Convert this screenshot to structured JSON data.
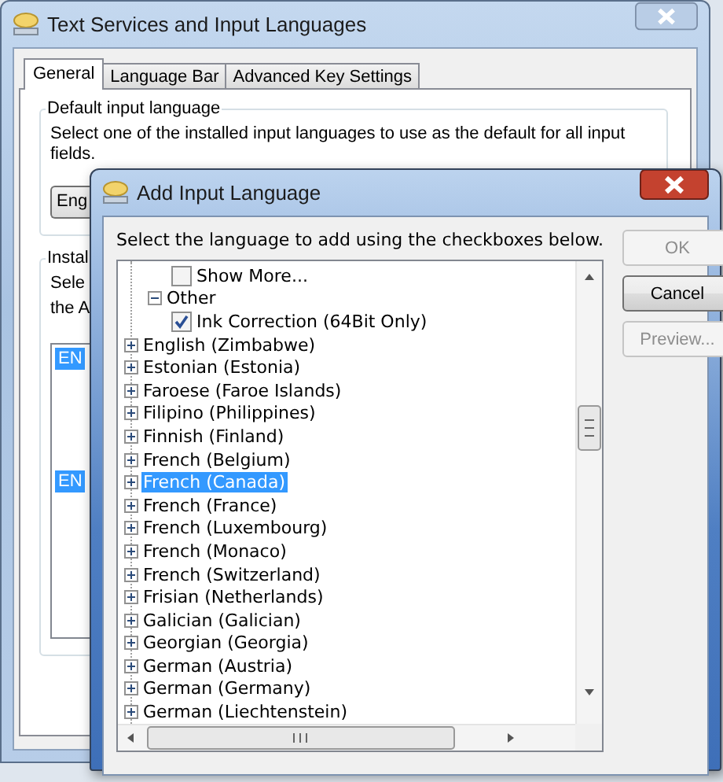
{
  "window": {
    "title": "Text Services and Input Languages"
  },
  "tabs": [
    {
      "label": "General",
      "selected": true
    },
    {
      "label": "Language Bar",
      "selected": false
    },
    {
      "label": "Advanced Key Settings",
      "selected": false
    }
  ],
  "default_input_language": {
    "title": "Default input language",
    "description": "Select one of the installed input languages to use as the default for all input fields.",
    "dropdown_value": "Eng"
  },
  "installed_services": {
    "title": "Instal",
    "description_lines": [
      "Sele",
      "the A"
    ],
    "items": [
      {
        "label": "EN",
        "selected": true
      },
      {
        "label": "EN",
        "selected": true
      }
    ]
  },
  "dialog": {
    "title": "Add Input Language",
    "instruction": "Select the language to add using the checkboxes below.",
    "tree": [
      {
        "children": [
          {
            "children": [
              {
                "label": "Show More...",
                "checked": false
              }
            ]
          },
          {
            "label": "Other",
            "expanded": true,
            "children": [
              {
                "label": "Ink Correction (64Bit Only)",
                "checked": true
              }
            ]
          }
        ]
      },
      {
        "label": "English (Zimbabwe)",
        "expanded": false,
        "selected": false
      },
      {
        "label": "Estonian (Estonia)",
        "expanded": false,
        "selected": false
      },
      {
        "label": "Faroese (Faroe Islands)",
        "expanded": false,
        "selected": false
      },
      {
        "label": "Filipino (Philippines)",
        "expanded": false,
        "selected": false
      },
      {
        "label": "Finnish (Finland)",
        "expanded": false,
        "selected": false
      },
      {
        "label": "French (Belgium)",
        "expanded": false,
        "selected": false
      },
      {
        "label": "French (Canada)",
        "expanded": false,
        "selected": true
      },
      {
        "label": "French (France)",
        "expanded": false,
        "selected": false
      },
      {
        "label": "French (Luxembourg)",
        "expanded": false,
        "selected": false
      },
      {
        "label": "French (Monaco)",
        "expanded": false,
        "selected": false
      },
      {
        "label": "French (Switzerland)",
        "expanded": false,
        "selected": false
      },
      {
        "label": "Frisian (Netherlands)",
        "expanded": false,
        "selected": false
      },
      {
        "label": "Galician (Galician)",
        "expanded": false,
        "selected": false
      },
      {
        "label": "Georgian (Georgia)",
        "expanded": false,
        "selected": false
      },
      {
        "label": "German (Austria)",
        "expanded": false,
        "selected": false
      },
      {
        "label": "German (Germany)",
        "expanded": false,
        "selected": false
      },
      {
        "label": "German (Liechtenstein)",
        "expanded": false,
        "selected": false
      }
    ],
    "buttons": [
      {
        "label": "OK",
        "disabled": true
      },
      {
        "label": "Cancel",
        "disabled": false
      },
      {
        "label": "Preview...",
        "disabled": true
      }
    ]
  }
}
